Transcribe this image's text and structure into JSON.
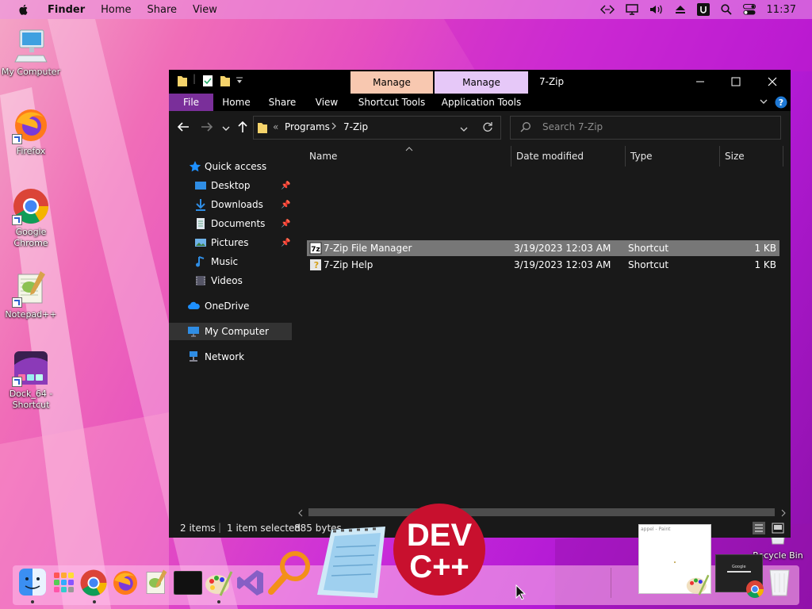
{
  "menubar": {
    "app_name": "Finder",
    "items": [
      "Home",
      "Share",
      "View"
    ],
    "clock": "11:37"
  },
  "desktop": {
    "icons": [
      {
        "label": "My Computer"
      },
      {
        "label": "Firefox"
      },
      {
        "label": "Google Chrome"
      },
      {
        "label": "Notepad++"
      },
      {
        "label": "Dock_64 - Shortcut"
      },
      {
        "label": "Recycle Bin"
      }
    ]
  },
  "explorer": {
    "title": "7-Zip",
    "context_tabs": [
      "Manage",
      "Manage"
    ],
    "ribbon_tabs": [
      "File",
      "Home",
      "Share",
      "View",
      "Shortcut Tools",
      "Application Tools"
    ],
    "address": {
      "prefix": "«",
      "segments": [
        "Programs",
        "7-Zip"
      ]
    },
    "search_placeholder": "Search 7-Zip",
    "nav": {
      "quick_access": "Quick access",
      "pinned": [
        "Desktop",
        "Downloads",
        "Documents",
        "Pictures"
      ],
      "unpinned": [
        "Music",
        "Videos"
      ],
      "onedrive": "OneDrive",
      "my_computer": "My Computer",
      "network": "Network"
    },
    "columns": [
      "Name",
      "Date modified",
      "Type",
      "Size"
    ],
    "files": [
      {
        "name": "7-Zip File Manager",
        "date": "3/19/2023 12:03 AM",
        "type": "Shortcut",
        "size": "1 KB",
        "selected": true
      },
      {
        "name": "7-Zip Help",
        "date": "3/19/2023 12:03 AM",
        "type": "Shortcut",
        "size": "1 KB",
        "selected": false
      }
    ],
    "status": {
      "count": "2 items",
      "selected": "1 item selected",
      "size": "885 bytes"
    }
  },
  "dock_overlay": {
    "devcpp_text": [
      "DEV",
      "C++"
    ],
    "paint_preview_title": "appel - Paint",
    "chrome_preview_title": "Google"
  },
  "colors": {
    "accent": "#7a2f9a",
    "manage1": "#f8c8b0",
    "manage2": "#e6c8f8",
    "selection": "#777777"
  }
}
